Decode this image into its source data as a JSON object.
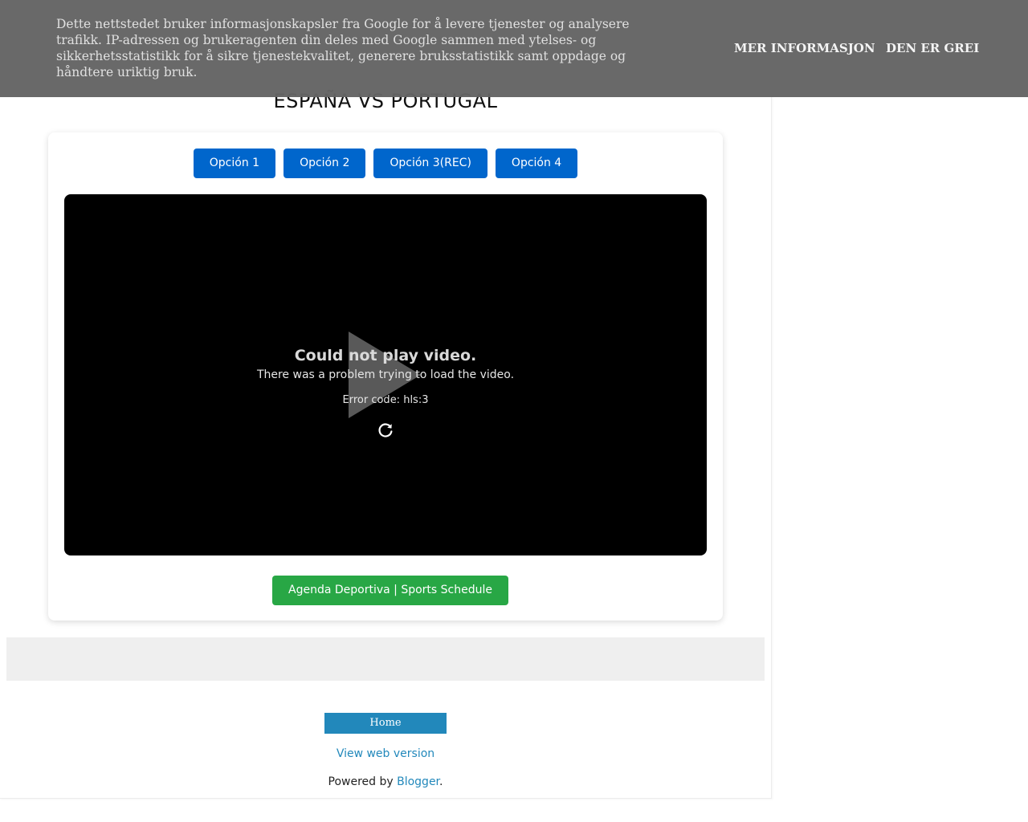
{
  "page": {
    "match_title": "ESPAÑA VS PORTUGAL"
  },
  "options": [
    {
      "label": "Opción 1"
    },
    {
      "label": "Opción 2"
    },
    {
      "label": "Opción 3(REC)"
    },
    {
      "label": "Opción 4"
    }
  ],
  "player": {
    "error_heading": "Could not play video.",
    "error_message": "There was a problem trying to load the video.",
    "error_code": "Error code: hls:3",
    "play_icon": "play-icon",
    "retry_icon": "refresh-icon"
  },
  "agenda_button": {
    "label": "Agenda Deportiva | Sports Schedule"
  },
  "footer": {
    "home_label": "Home",
    "web_version_label": "View web version",
    "powered_prefix": "Powered by ",
    "powered_link": "Blogger",
    "powered_suffix": "."
  },
  "cookie_banner": {
    "text": "Dette nettstedet bruker informasjonskapsler fra Google for å levere tjenester og analysere trafikk. IP-adressen og brukeragenten din deles med Google sammen med ytelses- og sikkerhetsstatistikk for å sikre tjenestekvalitet, generere bruksstatistikk samt oppdage og håndtere uriktig bruk.",
    "more_info_label": "MER INFORMASJON",
    "accept_label": "DEN ER GREI"
  },
  "colors": {
    "option_button": "#0066cc",
    "agenda_button": "#28a745",
    "link": "#2288bb",
    "banner_background": "#646464"
  }
}
